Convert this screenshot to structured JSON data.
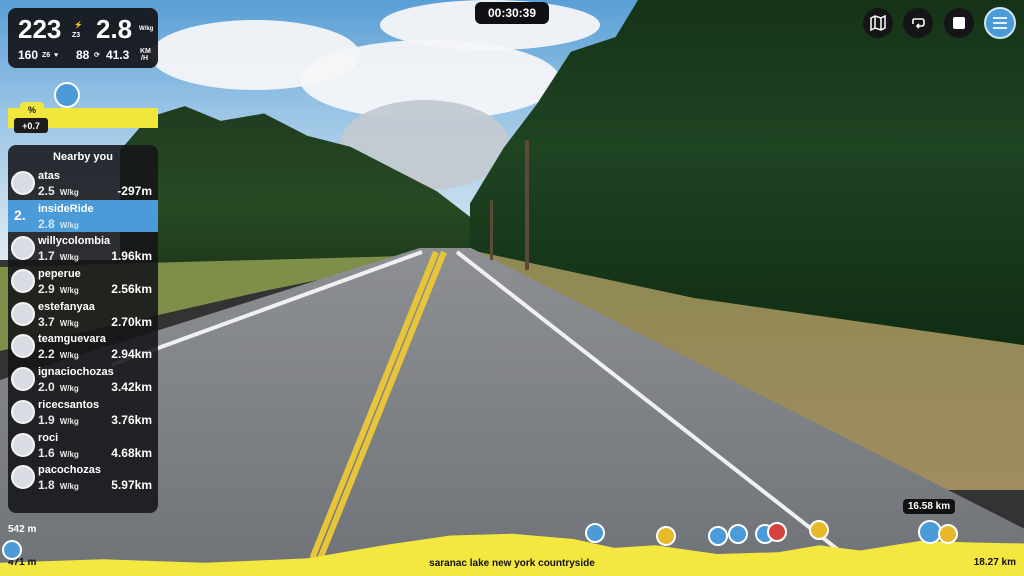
{
  "stats": {
    "power": "223",
    "power_zone_top": "⚡",
    "power_zone": "Z3",
    "wkg": "2.8",
    "wkg_unit": "W/kg",
    "heart_rate": "160",
    "hr_zone": "Z6",
    "hr_icon": "heart-icon",
    "cadence": "88",
    "cadence_icon": "cadence-icon",
    "speed": "41.3",
    "speed_unit_top": "KM",
    "speed_unit_bottom": "/H"
  },
  "timer": "00:30:39",
  "grade": {
    "symbol": "%",
    "value": "+0.7"
  },
  "top_buttons": [
    {
      "name": "map-button",
      "icon": "map-icon"
    },
    {
      "name": "loop-button",
      "icon": "loop-icon"
    },
    {
      "name": "stop-button",
      "icon": "stop-icon"
    },
    {
      "name": "menu-button",
      "icon": "menu-icon"
    }
  ],
  "nearby": {
    "title": "Nearby you",
    "riders": [
      {
        "name": "atas",
        "wkg": "2.5",
        "unit": "W/kg",
        "dist": "-297m",
        "me": false,
        "pos": ""
      },
      {
        "name": "insideRide",
        "wkg": "2.8",
        "unit": "W/kg",
        "dist": "",
        "me": true,
        "pos": "2."
      },
      {
        "name": "willycolombia",
        "wkg": "1.7",
        "unit": "W/kg",
        "dist": "1.96km",
        "me": false,
        "pos": ""
      },
      {
        "name": "peperue",
        "wkg": "2.9",
        "unit": "W/kg",
        "dist": "2.56km",
        "me": false,
        "pos": ""
      },
      {
        "name": "estefanyaa",
        "wkg": "3.7",
        "unit": "W/kg",
        "dist": "2.70km",
        "me": false,
        "pos": ""
      },
      {
        "name": "teamguevara",
        "wkg": "2.2",
        "unit": "W/kg",
        "dist": "2.94km",
        "me": false,
        "pos": ""
      },
      {
        "name": "ignaciochozas",
        "wkg": "2.0",
        "unit": "W/kg",
        "dist": "3.42km",
        "me": false,
        "pos": ""
      },
      {
        "name": "ricecsantos",
        "wkg": "1.9",
        "unit": "W/kg",
        "dist": "3.76km",
        "me": false,
        "pos": ""
      },
      {
        "name": "roci",
        "wkg": "1.6",
        "unit": "W/kg",
        "dist": "4.68km",
        "me": false,
        "pos": ""
      },
      {
        "name": "pacochozas",
        "wkg": "1.8",
        "unit": "W/kg",
        "dist": "5.97km",
        "me": false,
        "pos": ""
      }
    ]
  },
  "elevation": {
    "max_elev": "542 m",
    "min_elev": "471 m",
    "route_name": "saranac lake new york countryside",
    "remaining": "18.27 km",
    "current_marker": "16.58 km"
  },
  "colors": {
    "accent": "#4a9bd8",
    "elevation": "#f4e73f",
    "panel": "#141418"
  }
}
